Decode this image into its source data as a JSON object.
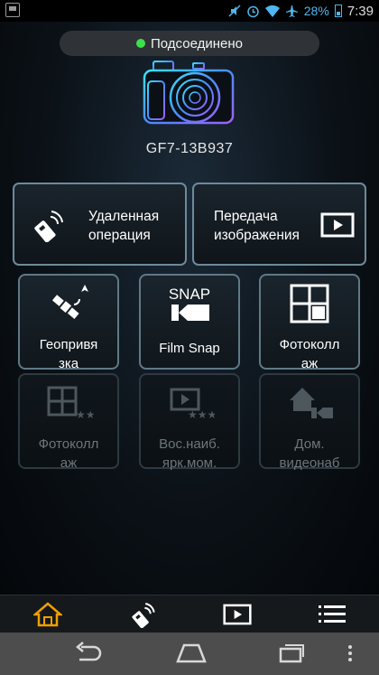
{
  "status_bar": {
    "battery_percent": "28%",
    "time": "7:39",
    "icons": [
      "screenshot-icon",
      "mute-icon",
      "alarm-icon",
      "wifi-icon",
      "airplane-icon",
      "battery-icon"
    ]
  },
  "connection": {
    "status_text": "Подсоединено",
    "status_color": "#3ee04a"
  },
  "camera": {
    "model_name": "GF7-13B937"
  },
  "main_buttons": {
    "remote": {
      "line1": "Удаленная",
      "line2": "операция",
      "icon": "remote-control-icon"
    },
    "transfer": {
      "line1": "Передача",
      "line2": "изображения",
      "icon": "play-icon"
    }
  },
  "tiles": [
    {
      "line1": "Геопривя",
      "line2": "зка",
      "icon": "satellite-icon",
      "enabled": true
    },
    {
      "line1": "Film Snap",
      "line2": "",
      "icon": "snap-icon",
      "icon_text": "SNAP",
      "enabled": true
    },
    {
      "line1": "Фотоколл",
      "line2": "аж",
      "icon": "collage-icon",
      "enabled": true
    },
    {
      "line1": "Фотоколл",
      "line2": "аж",
      "icon": "collage-stars-icon",
      "enabled": false
    },
    {
      "line1": "Вос.наиб.",
      "line2": "ярк.мом.",
      "icon": "highlight-playback-icon",
      "enabled": false
    },
    {
      "line1": "Дом.",
      "line2": "видеонаб",
      "icon": "home-monitor-icon",
      "enabled": false
    }
  ],
  "tab_bar": [
    "home-icon",
    "remote-control-icon",
    "play-icon",
    "menu-icon"
  ],
  "colors": {
    "accent_home": "#f0a000",
    "disabled_text": "#6d767c",
    "button_border": "#6d8a99"
  }
}
